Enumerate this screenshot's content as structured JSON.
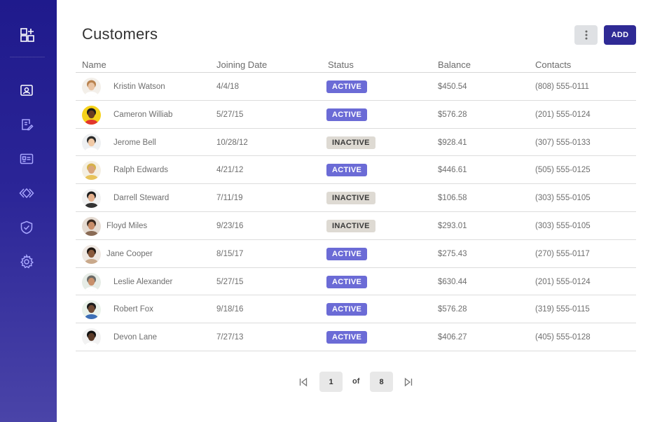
{
  "sidebar": {
    "logo_icon": "dashboard-add-icon",
    "items": [
      {
        "name": "customers",
        "icon": "contact-card-icon"
      },
      {
        "name": "reports",
        "icon": "document-edit-icon"
      },
      {
        "name": "ids",
        "icon": "id-card-icon"
      },
      {
        "name": "code",
        "icon": "code-diamond-icon"
      },
      {
        "name": "security",
        "icon": "shield-check-icon"
      },
      {
        "name": "settings",
        "icon": "gear-icon"
      }
    ],
    "colors": {
      "gradient_top": "#1f1a8c",
      "gradient_bottom": "#4a44a8",
      "icon": "#a8a6ff"
    }
  },
  "header": {
    "title": "Customers",
    "more_icon": "vertical-dots-icon",
    "add_label": "ADD"
  },
  "table": {
    "columns": [
      "Name",
      "Joining Date",
      "Status",
      "Balance",
      "Contacts"
    ],
    "rows": [
      {
        "name": "Kristin Watson",
        "date": "4/4/18",
        "status": "ACTIVE",
        "balance": "$450.54",
        "contact": "(808) 555-0111"
      },
      {
        "name": "Cameron Williab",
        "date": "5/27/15",
        "status": "ACTIVE",
        "balance": "$576.28",
        "contact": "(201) 555-0124"
      },
      {
        "name": "Jerome Bell",
        "date": "10/28/12",
        "status": "INACTIVE",
        "balance": "$928.41",
        "contact": "(307) 555-0133"
      },
      {
        "name": "Ralph Edwards",
        "date": "4/21/12",
        "status": "ACTIVE",
        "balance": "$446.61",
        "contact": "(505) 555-0125"
      },
      {
        "name": "Darrell Steward",
        "date": "7/11/19",
        "status": "INACTIVE",
        "balance": "$106.58",
        "contact": "(303) 555-0105"
      },
      {
        "name": "Floyd Miles",
        "date": "9/23/16",
        "status": "INACTIVE",
        "balance": "$293.01",
        "contact": "(303) 555-0105"
      },
      {
        "name": "Jane Cooper",
        "date": "8/15/17",
        "status": "ACTIVE",
        "balance": "$275.43",
        "contact": "(270) 555-0117"
      },
      {
        "name": "Leslie Alexander",
        "date": "5/27/15",
        "status": "ACTIVE",
        "balance": "$630.44",
        "contact": "(201) 555-0124"
      },
      {
        "name": "Robert Fox",
        "date": "9/18/16",
        "status": "ACTIVE",
        "balance": "$576.28",
        "contact": "(319) 555-0115"
      },
      {
        "name": "Devon Lane",
        "date": "7/27/13",
        "status": "ACTIVE",
        "balance": "$406.27",
        "contact": "(405) 555-0128"
      }
    ]
  },
  "pagination": {
    "current": "1",
    "of_label": "of",
    "total": "8",
    "first_icon": "first-page-icon",
    "last_icon": "last-page-icon"
  },
  "colors": {
    "active_badge": "#6b6bd6",
    "inactive_badge": "#dedad3",
    "primary": "#2f2a95"
  }
}
